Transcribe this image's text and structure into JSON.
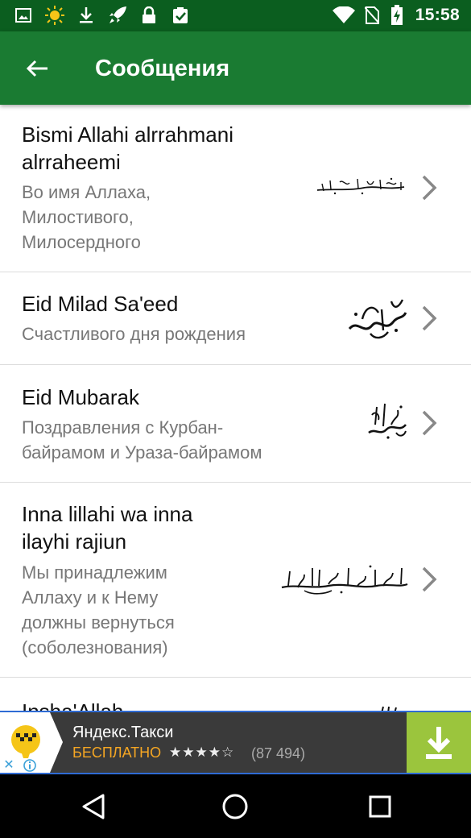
{
  "status_bar": {
    "time": "15:58",
    "icons": [
      "image-icon",
      "sun-icon",
      "download-icon",
      "rocket-icon",
      "lock-icon",
      "clipboard-check-icon",
      "wifi-icon",
      "no-sim-icon",
      "battery-charging-icon"
    ]
  },
  "app_bar": {
    "title": "Сообщения",
    "back_icon": "arrow-back-icon"
  },
  "messages": [
    {
      "title_lines": [
        "Bismi Allahi alrrahmani",
        "alrraheemi"
      ],
      "subtitle_lines": [
        "Во имя Аллаха,",
        "Милостивого,",
        "Милосердного"
      ]
    },
    {
      "title_lines": [
        "Eid Milad Sa'eed"
      ],
      "subtitle_lines": [
        "Счастливого дня рождения"
      ]
    },
    {
      "title_lines": [
        "Eid Mubarak"
      ],
      "subtitle_lines": [
        "Поздравления с Курбан-",
        "байрамом и Ураза-байрамом"
      ]
    },
    {
      "title_lines": [
        "Inna lillahi wa inna",
        "ilayhi rajiun"
      ],
      "subtitle_lines": [
        "Мы принадлежим",
        "Аллаху и к Нему",
        "должны вернуться",
        "(соболезнования)"
      ]
    },
    {
      "title_lines": [
        "Insha'Allah"
      ],
      "subtitle_lines": []
    }
  ],
  "ad": {
    "app_name": "Яндекс.Такси",
    "price": "БЕСПЛАТНО",
    "stars": "★★★★☆",
    "rating_count": "(87 494)",
    "close_label": "✕",
    "colors": {
      "price": "#f5a623",
      "download_bg": "#9bc53d",
      "border": "#2f6bd4"
    }
  },
  "colors": {
    "status_bar": "#0b5e1f",
    "app_bar": "#1a7b32",
    "title_text": "#111111",
    "subtitle_text": "#777777"
  }
}
